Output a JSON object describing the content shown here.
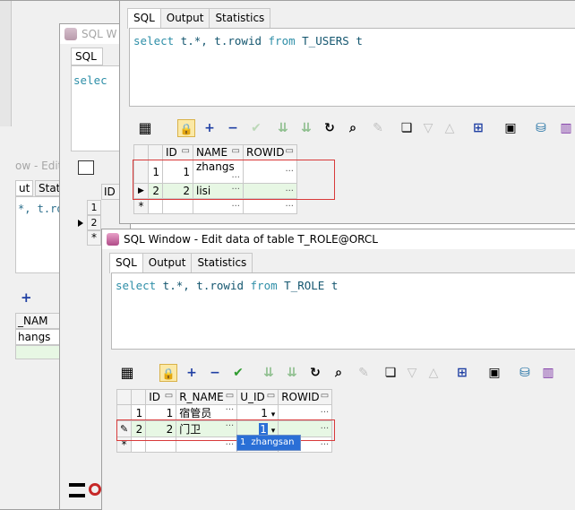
{
  "windows": {
    "back_left": {
      "title_fragment": "ow - Edit",
      "tabs": [
        "ut",
        "Stati"
      ],
      "editor_text": "*, t.ro",
      "grid_header_fragment": "_NAM",
      "grid_value_fragment": "hangs",
      "add_glyph": "+"
    },
    "back_mid": {
      "title": "SQL W",
      "tab_sql": "SQL",
      "editor_text": "selec",
      "grid_header_id": "ID",
      "rows": [
        "1",
        "2"
      ],
      "new_row_marker": "*"
    },
    "users": {
      "tabs": [
        "SQL",
        "Output",
        "Statistics"
      ],
      "sql": {
        "kw1": "select",
        "rest1": " t.*, t.rowid ",
        "kw2": "from",
        "table": " T_USERS t"
      },
      "columns": [
        "ID",
        "NAME",
        "ROWID"
      ],
      "rows": [
        {
          "row": "1",
          "id": "1",
          "name": "zhangs",
          "rowid": ""
        },
        {
          "row": "2",
          "id": "2",
          "name": "lisi",
          "rowid": ""
        }
      ],
      "new_row_marker": "*"
    },
    "role": {
      "title": "SQL Window - Edit data of table T_ROLE@ORCL",
      "tabs": [
        "SQL",
        "Output",
        "Statistics"
      ],
      "sql": {
        "kw1": "select",
        "rest1": " t.*, t.rowid ",
        "kw2": "from",
        "table": " T_ROLE t"
      },
      "columns": [
        "ID",
        "R_NAME",
        "U_ID",
        "ROWID"
      ],
      "rows": [
        {
          "row": "1",
          "id": "1",
          "r_name": "宿管员",
          "u_id": "1",
          "rowid": ""
        },
        {
          "row": "2",
          "id": "2",
          "r_name": "门卫",
          "u_id": "1",
          "rowid": ""
        }
      ],
      "new_row_marker": "*",
      "dropdown_option": {
        "id": "1",
        "name": "zhangsan"
      }
    }
  },
  "toolbar_glyphs": {
    "add": "+",
    "remove": "−",
    "post": "✔",
    "refresh": "↻",
    "find": "⌕"
  },
  "colors": {
    "accent_red_box": "#d83a3a",
    "selected_row": "#e7f7e4",
    "sql_keyword": "#2f8fa8",
    "dropdown_highlight": "#2a6fd6"
  }
}
